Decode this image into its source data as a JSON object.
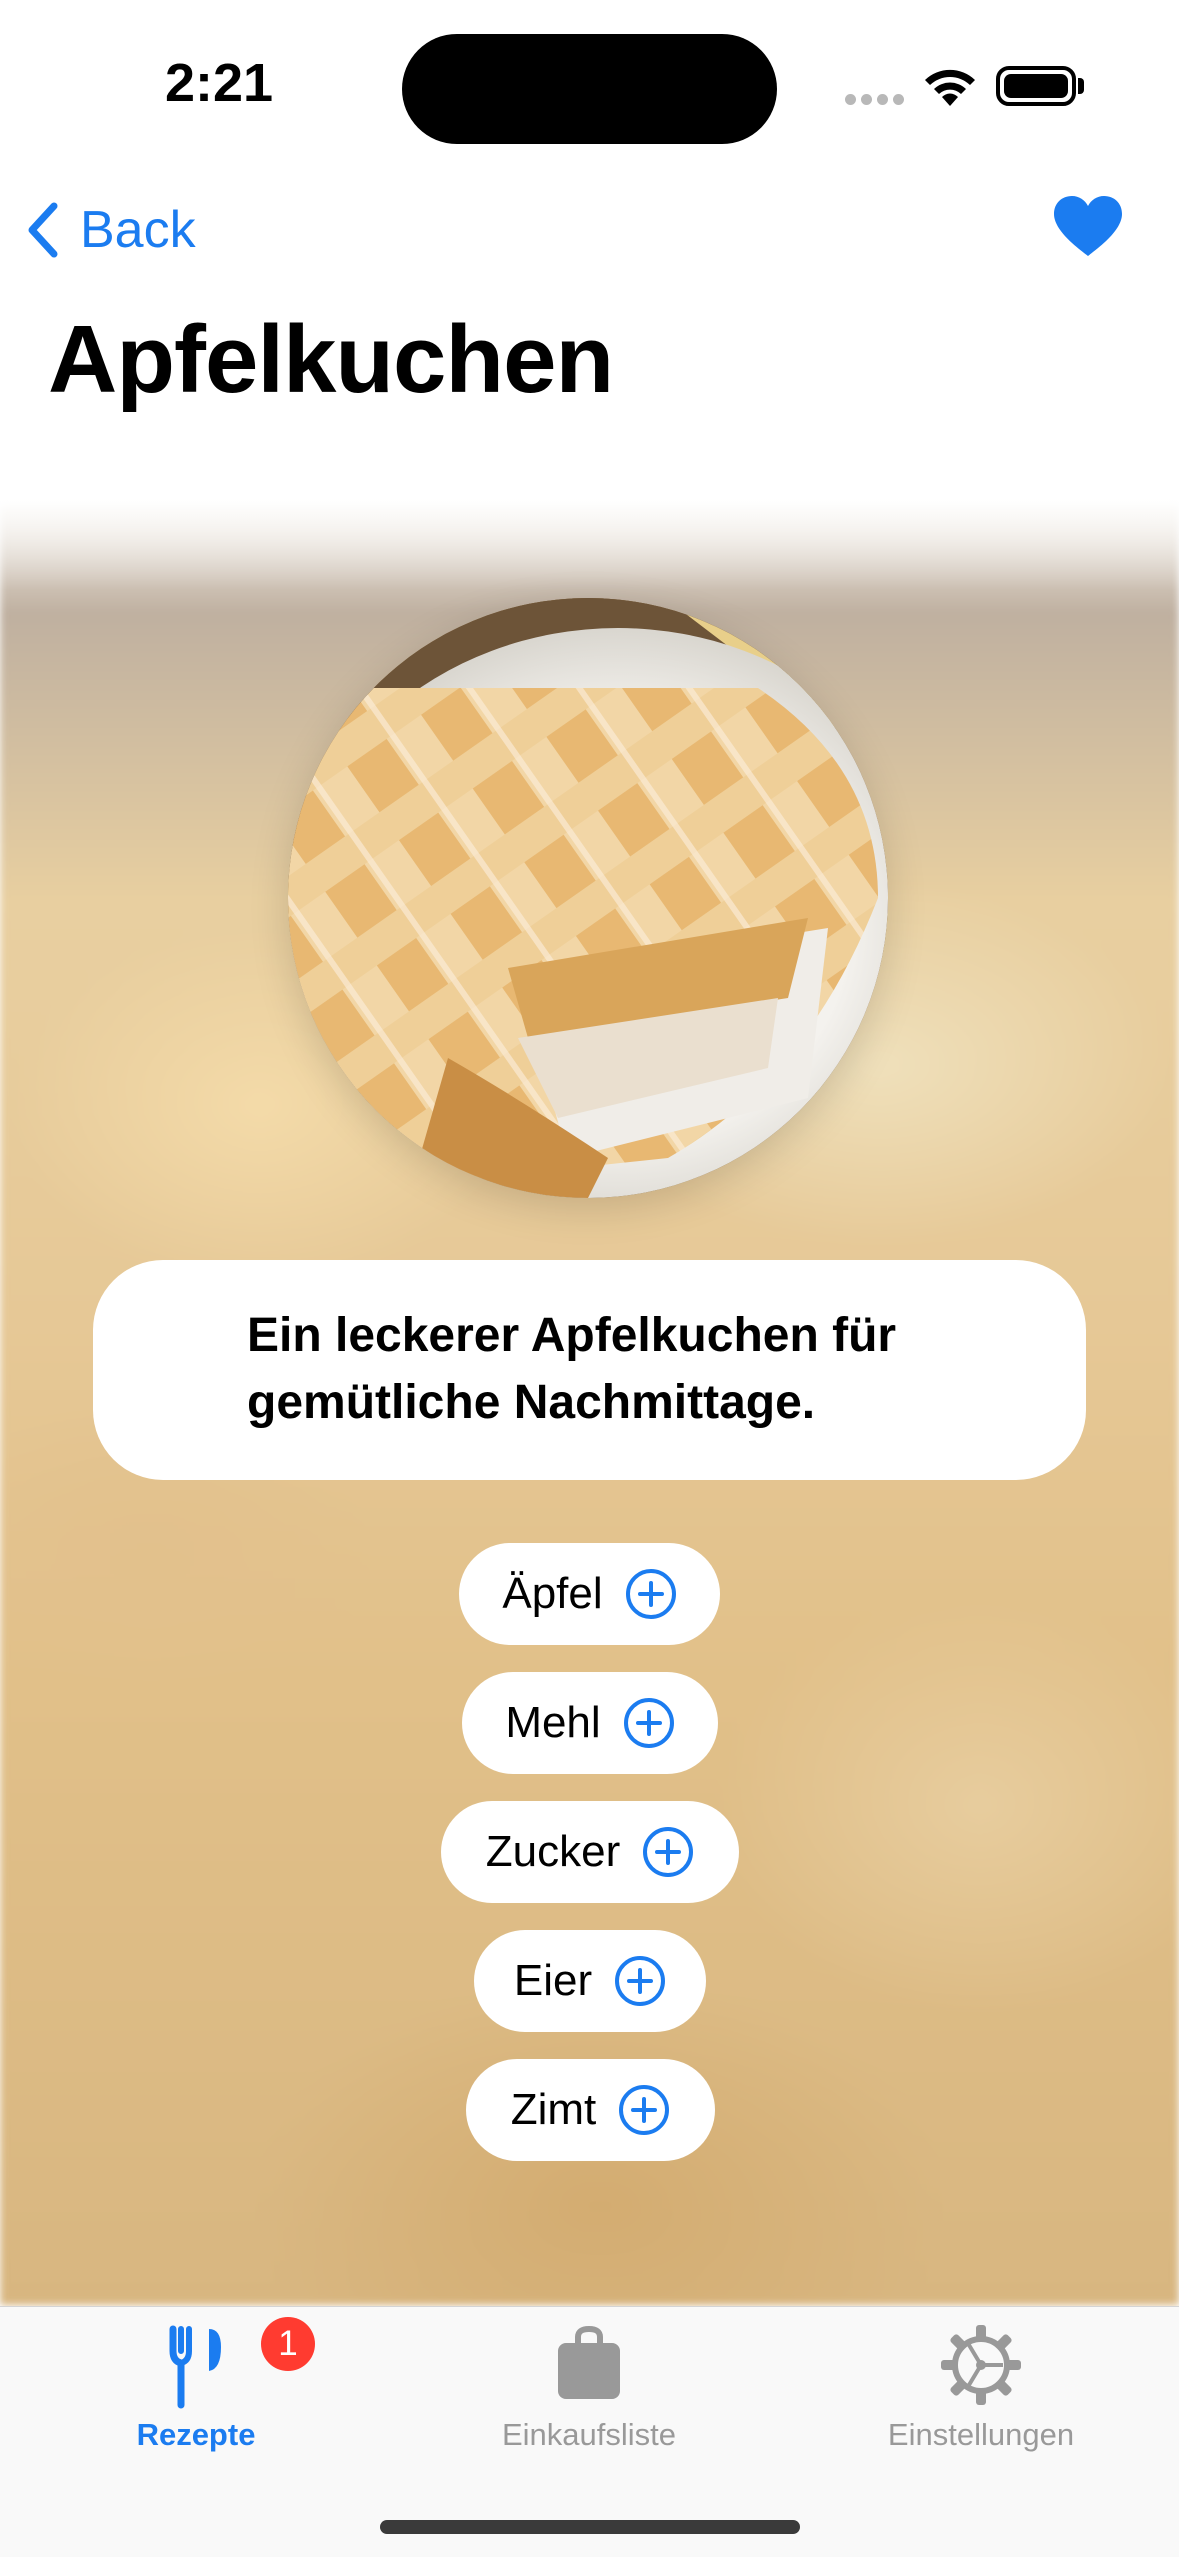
{
  "status_bar": {
    "time": "2:21"
  },
  "nav": {
    "back_label": "Back"
  },
  "recipe": {
    "title": "Apfelkuchen",
    "description": "Ein leckerer Apfelkuchen für gemütliche Nachmittage.",
    "ingredients": [
      "Äpfel",
      "Mehl",
      "Zucker",
      "Eier",
      "Zimt"
    ]
  },
  "tabs": [
    {
      "label": "Rezepte",
      "badge": "1",
      "selected": true,
      "icon": "fork-knife-icon"
    },
    {
      "label": "Einkaufsliste",
      "selected": false,
      "icon": "bag-icon"
    },
    {
      "label": "Einstellungen",
      "selected": false,
      "icon": "gear-icon"
    }
  ],
  "colors": {
    "accent": "#1b7cf0",
    "inactive": "#999999",
    "badge": "#ff3b30"
  }
}
